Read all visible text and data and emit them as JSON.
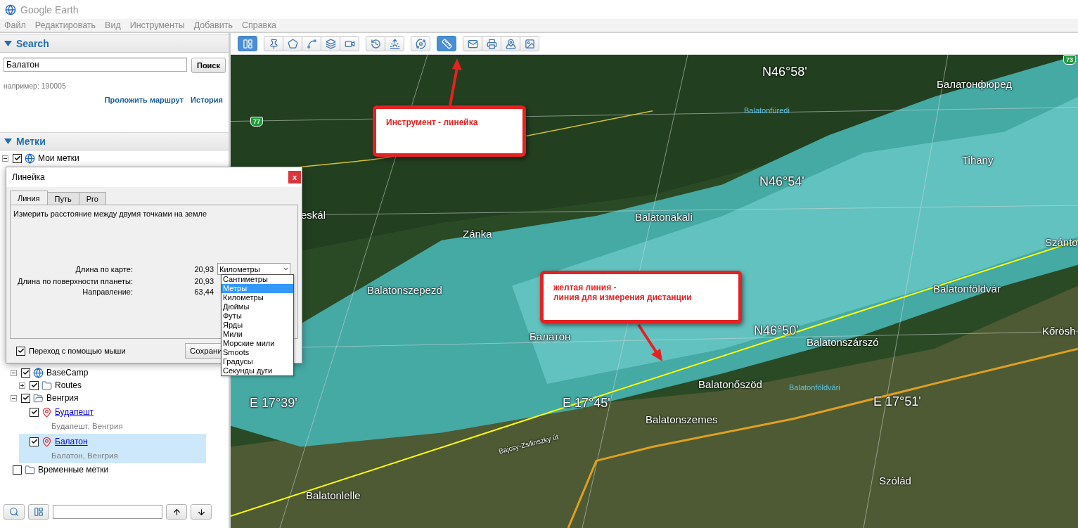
{
  "window": {
    "title": "Google Earth"
  },
  "menu": [
    "Файл",
    "Редактировать",
    "Вид",
    "Инструменты",
    "Добавить",
    "Справка"
  ],
  "search": {
    "heading": "Search",
    "expanded": true,
    "value": "Балатон",
    "button": "Поиск",
    "hint": "например: 190005",
    "links": [
      "Проложить маршрут",
      "История"
    ]
  },
  "places": {
    "heading": "Метки",
    "expanded": true,
    "tree": [
      {
        "label": "Мои метки",
        "kind": "globe",
        "checked": true,
        "expanded": true,
        "children": [
          {
            "label": "BaseCamp",
            "kind": "globe",
            "checked": true,
            "expanded": true,
            "children": [
              {
                "label": "Routes",
                "kind": "folder",
                "checked": true,
                "expanded": false
              }
            ]
          },
          {
            "label": "Венгрия",
            "kind": "open-folder",
            "checked": true,
            "expanded": true,
            "children": [
              {
                "label": "Будапешт",
                "kind": "placemark",
                "checked": true,
                "selected": false,
                "subtitle": "Будапешт, Венгрия"
              },
              {
                "label": "Балатон",
                "kind": "placemark",
                "checked": true,
                "selected": true,
                "subtitle": "Балатон, Венгрия"
              }
            ]
          }
        ]
      },
      {
        "label": "Временные метки",
        "kind": "folder",
        "checked": false
      }
    ]
  },
  "toolbar": {
    "groups": [
      [
        {
          "kind": "sidebar",
          "selected": true
        }
      ],
      [
        {
          "kind": "placemark",
          "selected": false
        },
        {
          "kind": "polygon",
          "selected": false
        },
        {
          "kind": "path",
          "selected": false
        },
        {
          "kind": "overlay",
          "selected": false
        },
        {
          "kind": "tour",
          "selected": false
        }
      ],
      [
        {
          "kind": "history",
          "selected": false
        },
        {
          "kind": "sun",
          "selected": false
        }
      ],
      [
        {
          "kind": "planet",
          "selected": false
        }
      ],
      [
        {
          "kind": "ruler",
          "selected": true
        }
      ],
      [
        {
          "kind": "email",
          "selected": false
        },
        {
          "kind": "print",
          "selected": false
        },
        {
          "kind": "map",
          "selected": false
        },
        {
          "kind": "image",
          "selected": false
        }
      ]
    ]
  },
  "ruler_dialog": {
    "title": "Линейка",
    "close": "x",
    "tabs": [
      {
        "label": "Линия",
        "selected": true
      },
      {
        "label": "Путь",
        "selected": false
      },
      {
        "label": "Pro",
        "selected": false
      }
    ],
    "description": "Измерить расстояние между двумя точками на земле",
    "rows": [
      {
        "label": "Длина по карте:",
        "value": "20,93"
      },
      {
        "label": "Длина по поверхности планеты:",
        "value": "20,93"
      },
      {
        "label": "Направление:",
        "value": "63,44"
      }
    ],
    "unit": "Километры",
    "unit_options": [
      {
        "label": "Сантиметры",
        "selected": false
      },
      {
        "label": "Метры",
        "selected": true
      },
      {
        "label": "Километры",
        "selected": false
      },
      {
        "label": "Дюймы",
        "selected": false
      },
      {
        "label": "Футы",
        "selected": false
      },
      {
        "label": "Ярды",
        "selected": false
      },
      {
        "label": "Мили",
        "selected": false
      },
      {
        "label": "Морские мили",
        "selected": false
      },
      {
        "label": "Smoots",
        "selected": false
      },
      {
        "label": "Градусы",
        "selected": false
      },
      {
        "label": "Секунды дуги",
        "selected": false
      }
    ],
    "mouse_navigation": {
      "label": "Переход с помощью мыши",
      "checked": true
    },
    "save_button": "Сохрани"
  },
  "map": {
    "shields": [
      "77",
      "73"
    ],
    "labels": [
      {
        "text": "N46°58'",
        "kind": "grid"
      },
      {
        "text": "Балатонфюред",
        "kind": "town"
      },
      {
        "text": "Balatonfüredi",
        "kind": "poi"
      },
      {
        "text": "Tihany",
        "kind": "town"
      },
      {
        "text": "N46°54'",
        "kind": "grid"
      },
      {
        "text": "Balatonakali",
        "kind": "town"
      },
      {
        "text": "eskál",
        "kind": "town"
      },
      {
        "text": "Zánka",
        "kind": "town"
      },
      {
        "text": "Szánto",
        "kind": "town"
      },
      {
        "text": "Balatonszepezd",
        "kind": "town"
      },
      {
        "text": "Balatonföldvár",
        "kind": "town"
      },
      {
        "text": "Kőrösh",
        "kind": "town"
      },
      {
        "text": "N46°50'",
        "kind": "grid"
      },
      {
        "text": "Балатон",
        "kind": "town"
      },
      {
        "text": "Balatonszárszó",
        "kind": "town"
      },
      {
        "text": "Balatonőszöd",
        "kind": "town"
      },
      {
        "text": "Balatonföldvári",
        "kind": "poi"
      },
      {
        "text": "E 17°39'",
        "kind": "grid"
      },
      {
        "text": "E 17°45'",
        "kind": "grid"
      },
      {
        "text": "E 17°51'",
        "kind": "grid"
      },
      {
        "text": "Balatonszemes",
        "kind": "town"
      },
      {
        "text": "Bajcsy-Zsilinszky út",
        "kind": "road"
      },
      {
        "text": "Balatonlelle",
        "kind": "town"
      },
      {
        "text": "Szólád",
        "kind": "town"
      }
    ],
    "callouts": [
      {
        "lines": [
          "Инструмент - линейка"
        ]
      },
      {
        "lines": [
          "желтая линия -",
          "линия для измерения дистанции"
        ]
      }
    ]
  }
}
